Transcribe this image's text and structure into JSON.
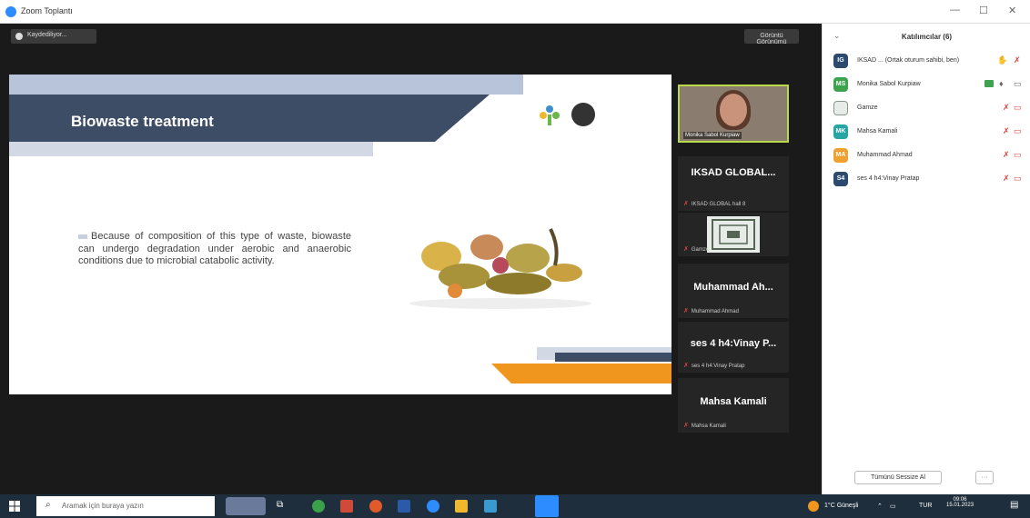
{
  "window": {
    "title": "Zoom Toplantı"
  },
  "toolbar": {
    "share_label": "Kaydediliyor...",
    "view_label": "Görüntü Görünümü"
  },
  "slide": {
    "heading": "Biowaste treatment",
    "bullet": "Because of composition of this type of waste, biowaste can undergo degradation under aerobic and anaerobic conditions due to microbial catabolic activity."
  },
  "video": {
    "caption": "Monika Sabol Kurpiaw"
  },
  "tiles": [
    {
      "name": "IKSAD GLOBAL...",
      "sub": "IKSAD GLOBAL hall 8"
    },
    {
      "name": "",
      "sub": "Gamze"
    },
    {
      "name": "Muhammad Ah...",
      "sub": "Muhammad Ahmad"
    },
    {
      "name": "ses 4 h4:Vinay P...",
      "sub": "ses 4 h4:Vinay Pratap"
    },
    {
      "name": "Mahsa Kamali",
      "sub": "Mahsa Kamali"
    }
  ],
  "participants": {
    "title": "Katılımcılar (6)",
    "items": [
      {
        "initials": "IG",
        "name": "IKSAD ... (Ortak oturum sahibi, ben)",
        "color": "#2b4a6e"
      },
      {
        "initials": "MS",
        "name": "Monika Sabol Kurpiaw",
        "color": "#3fa34d"
      },
      {
        "initials": "",
        "name": "Gamze",
        "color": "#8a9a8a"
      },
      {
        "initials": "MK",
        "name": "Mahsa Kamali",
        "color": "#27a4a4"
      },
      {
        "initials": "MA",
        "name": "Muhammad Ahmad",
        "color": "#f0a030"
      },
      {
        "initials": "S4",
        "name": "ses 4 h4:Vinay Pratap",
        "color": "#2b4a6e"
      }
    ],
    "invite_label": "Tümünü Sessize Al",
    "more_label": "···"
  },
  "taskbar": {
    "search_placeholder": "Aramak için buraya yazın",
    "weather": "1°C Güneşli",
    "lang": "TUR",
    "time": "09:06",
    "date": "15.01.2023"
  }
}
